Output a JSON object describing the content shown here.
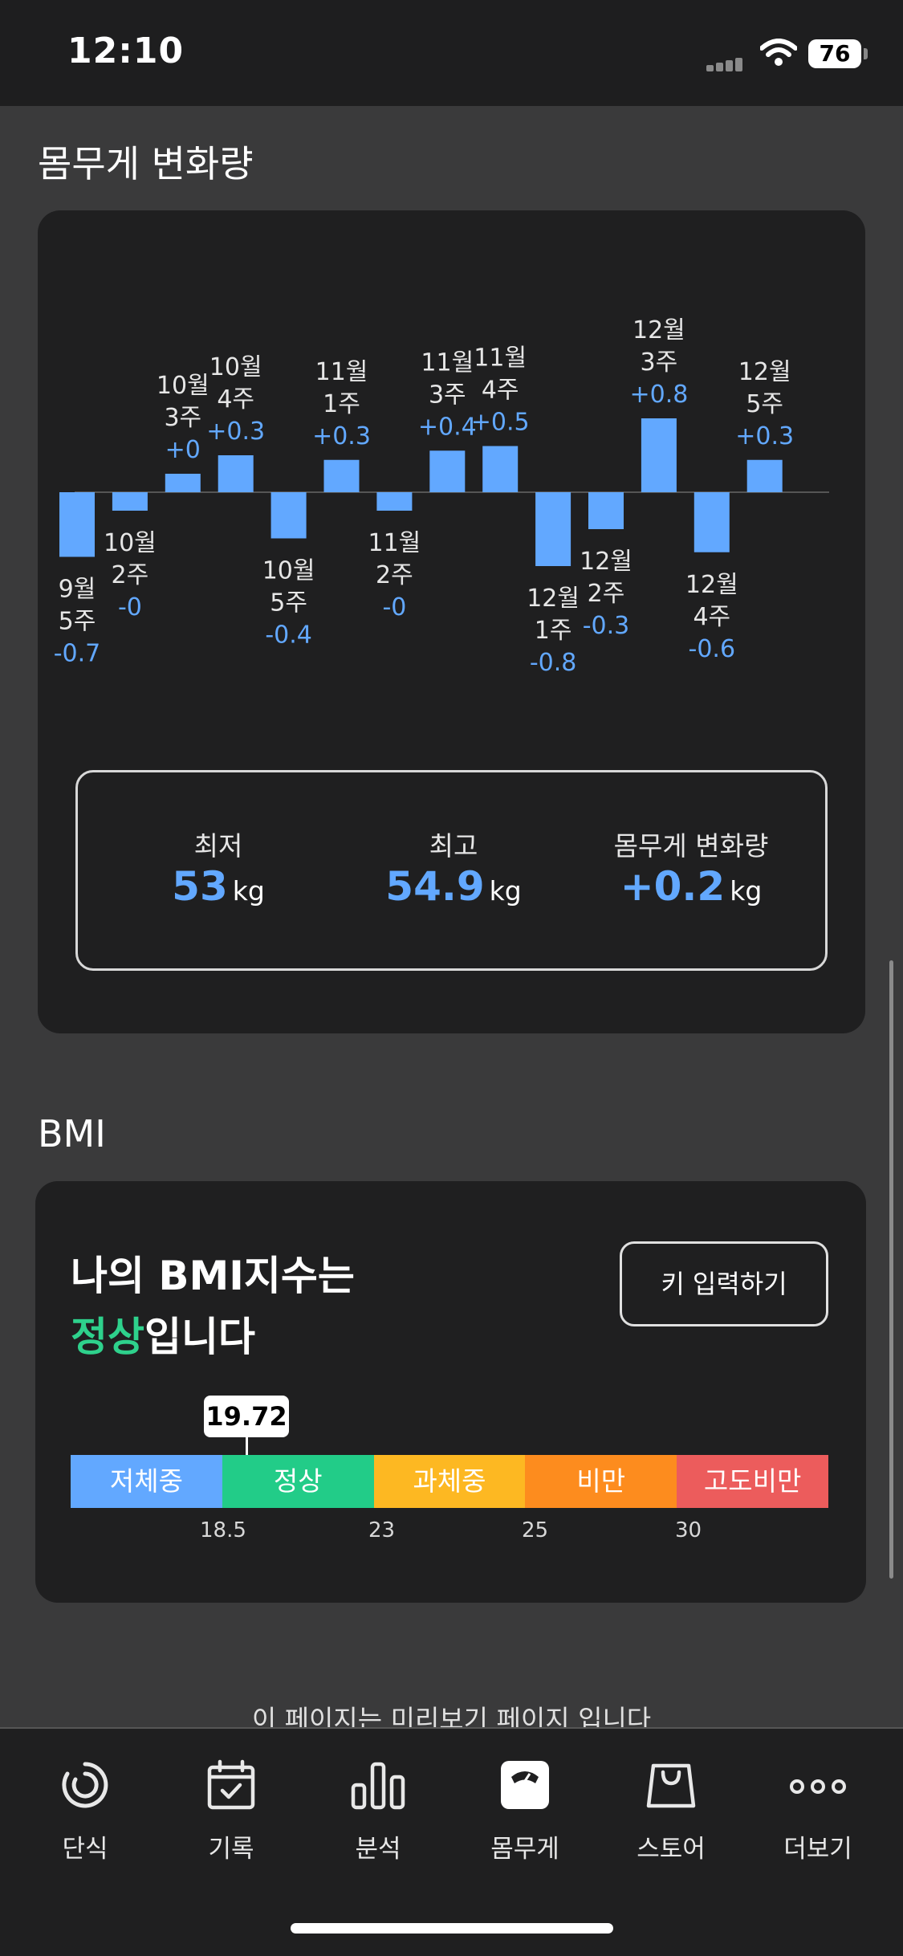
{
  "status_bar": {
    "time": "12:10",
    "battery": "76"
  },
  "weight_section": {
    "title": "몸무게 변화량",
    "chart_data": {
      "type": "bar",
      "title": "",
      "categories": [
        [
          "9월",
          "5주"
        ],
        [
          "10월",
          "2주"
        ],
        [
          "10월",
          "3주"
        ],
        [
          "10월",
          "4주"
        ],
        [
          "10월",
          "5주"
        ],
        [
          "11월",
          "1주"
        ],
        [
          "11월",
          "2주"
        ],
        [
          "11월",
          "3주"
        ],
        [
          "11월",
          "4주"
        ],
        [
          "12월",
          "1주"
        ],
        [
          "12월",
          "2주"
        ],
        [
          "12월",
          "3주"
        ],
        [
          "12월",
          "4주"
        ],
        [
          "12월",
          "5주"
        ]
      ],
      "value_labels": [
        "-0.7",
        "-0",
        "+0",
        "+0.3",
        "-0.4",
        "+0.3",
        "-0",
        "+0.4",
        "+0.5",
        "-0.8",
        "-0.3",
        "+0.8",
        "-0.6",
        "+0.3"
      ],
      "values": [
        -0.7,
        -0.2,
        0.2,
        0.4,
        -0.5,
        0.35,
        -0.2,
        0.45,
        0.5,
        -0.8,
        -0.4,
        0.8,
        -0.65,
        0.35
      ],
      "ylim": [
        -1,
        1
      ],
      "bar_color": "#62a8ff"
    },
    "stats": {
      "min_label": "최저",
      "min_value": "53",
      "min_unit": "kg",
      "max_label": "최고",
      "max_value": "54.9",
      "max_unit": "kg",
      "change_label": "몸무게 변화량",
      "change_value": "+0.2",
      "change_unit": "kg"
    }
  },
  "bmi_section": {
    "title": "BMI",
    "headline_prefix": "나의 BMI지수는",
    "status": "정상",
    "status_suffix": "입니다",
    "key_button": "키 입력하기",
    "value": "19.72",
    "segments": [
      {
        "label": "저체중",
        "color": "#62a8ff"
      },
      {
        "label": "정상",
        "color": "#22cc88"
      },
      {
        "label": "과체중",
        "color": "#fdb822"
      },
      {
        "label": "비만",
        "color": "#fd8c1e"
      },
      {
        "label": "고도비만",
        "color": "#ec5c5c"
      }
    ],
    "ticks": [
      "18.5",
      "23",
      "25",
      "30"
    ]
  },
  "preview_note": "이 페이지는 미리보기 페이지 입니다",
  "tabs": [
    {
      "label": "단식",
      "icon": "timer-icon"
    },
    {
      "label": "기록",
      "icon": "calendar-check-icon"
    },
    {
      "label": "분석",
      "icon": "bar-chart-icon"
    },
    {
      "label": "몸무게",
      "icon": "scale-icon"
    },
    {
      "label": "스토어",
      "icon": "shopping-bag-icon"
    },
    {
      "label": "더보기",
      "icon": "more-icon"
    }
  ],
  "active_tab": "몸무게"
}
